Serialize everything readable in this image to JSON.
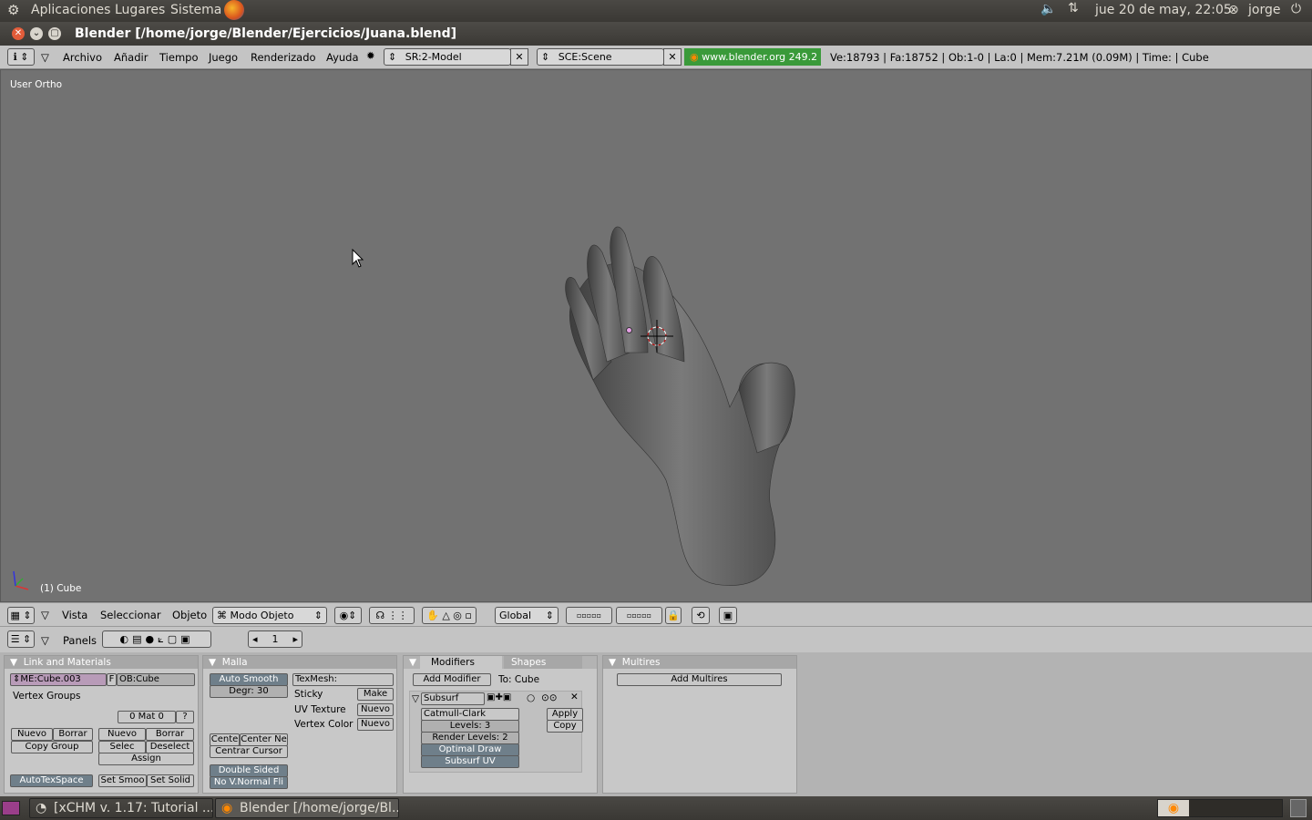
{
  "top_panel": {
    "menus": [
      "Aplicaciones",
      "Lugares",
      "Sistema"
    ],
    "clock": "jue 20 de may, 22:05",
    "user": "jorge"
  },
  "window": {
    "title": "Blender [/home/jorge/Blender/Ejercicios/Juana.blend]"
  },
  "blender_header": {
    "menus": [
      "Archivo",
      "Añadir",
      "Tiempo",
      "Juego",
      "Renderizado",
      "Ayuda"
    ],
    "screen_field": "SR:2-Model",
    "scene_field": "SCE:Scene",
    "version_link": "www.blender.org 249.2",
    "stats": "Ve:18793 | Fa:18752 | Ob:1-0 | La:0  | Mem:7.21M (0.09M)  | Time: | Cube"
  },
  "viewport": {
    "view_label": "User Ortho",
    "object_label": "(1) Cube"
  },
  "view3d_header": {
    "menus": [
      "Vista",
      "Seleccionar",
      "Objeto"
    ],
    "mode": "Modo Objeto",
    "orientation": "Global"
  },
  "buttons_header": {
    "panels_label": "Panels",
    "frame": "1"
  },
  "link_materials": {
    "title": "Link and Materials",
    "mesh_field": "ME:Cube.003",
    "f_flag": "F",
    "object_field": "OB:Cube",
    "vertex_groups": "Vertex Groups",
    "mat_field": "0 Mat 0",
    "question": "?",
    "vg_new": "Nuevo",
    "vg_delete": "Borrar",
    "copy_group": "Copy Group",
    "mat_new": "Nuevo",
    "mat_delete": "Borrar",
    "select": "Selec",
    "deselect": "Deselect",
    "assign": "Assign",
    "autotexspace": "AutoTexSpace",
    "set_smooth": "Set Smoo",
    "set_solid": "Set Solid"
  },
  "mesh": {
    "title": "Malla",
    "auto_smooth": "Auto Smooth",
    "degr": "Degr: 30",
    "texmesh": "TexMesh:",
    "sticky": "Sticky",
    "sticky_btn": "Make",
    "uv_texture": "UV Texture",
    "uv_btn": "Nuevo",
    "vertex_color": "Vertex Color",
    "vc_btn": "Nuevo",
    "center": "Cente",
    "center_new": "Center Ne",
    "center_cursor": "Centrar Cursor",
    "double_sided": "Double Sided",
    "no_vnormal": "No V.Normal Fli"
  },
  "modifiers": {
    "tab_modifiers": "Modifiers",
    "tab_shapes": "Shapes",
    "add_modifier": "Add Modifier",
    "to": "To: Cube",
    "subsurf_name": "Subsurf",
    "type": "Catmull-Clark",
    "levels": "Levels: 3",
    "render_levels": "Render Levels: 2",
    "optimal_draw": "Optimal Draw",
    "subsurf_uv": "Subsurf UV",
    "apply": "Apply",
    "copy": "Copy"
  },
  "multires": {
    "title": "Multires",
    "add_btn": "Add Multires"
  },
  "taskbar": {
    "tasks": [
      "[xCHM v. 1.17: Tutorial ...",
      "Blender [/home/jorge/Bl..."
    ]
  }
}
